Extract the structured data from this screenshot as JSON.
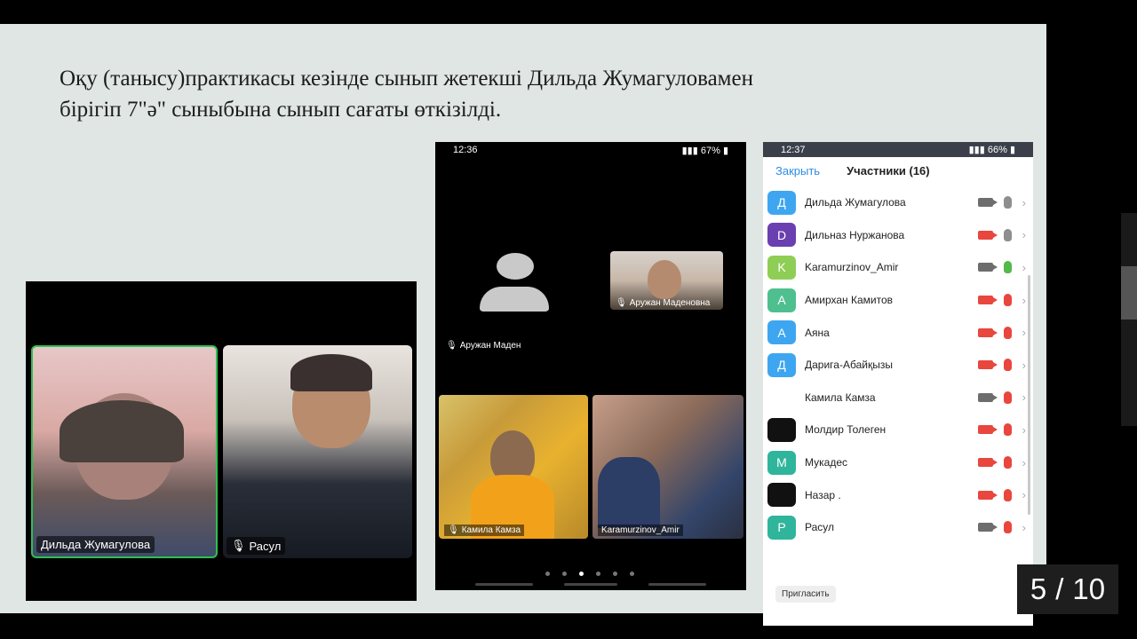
{
  "slide": {
    "heading_line1": "Оқу (танысу)практикасы кезінде сынып жетекші Дильда Жумагуловамен",
    "heading_line2": "бірігіп 7\"ә\" сыныбына сынып сағаты өткізілді."
  },
  "left_call": {
    "tiles": [
      {
        "name": "Дильда Жумагулова"
      },
      {
        "name": "Расул"
      }
    ]
  },
  "phone1": {
    "time": "12:36",
    "battery": "67%",
    "big_tile_name": "Аружан Маден",
    "tiles": [
      {
        "name": "Аружан Маденовна"
      },
      {
        "name": "Камила Камза"
      },
      {
        "name": "Karamurzinov_Amir"
      }
    ]
  },
  "phone2": {
    "time": "12:37",
    "battery": "66%",
    "close_label": "Закрыть",
    "title": "Участники (16)",
    "invite_label": "Пригласить",
    "participants": [
      {
        "initial": "Д",
        "name": "Дильда Жумагулова",
        "color": "#3ea6f0",
        "cam": "on",
        "mic": "on"
      },
      {
        "initial": "D",
        "name": "Дильназ Нуржанова",
        "color": "#6a3fb0",
        "cam": "off",
        "mic": "on"
      },
      {
        "initial": "K",
        "name": "Karamurzinov_Amir",
        "color": "#8fce55",
        "cam": "on",
        "mic": "active"
      },
      {
        "initial": "А",
        "name": "Амирхан Камитов",
        "color": "#4fbf8f",
        "cam": "off",
        "mic": "off"
      },
      {
        "initial": "А",
        "name": "Аяна",
        "color": "#3ea6f0",
        "cam": "off",
        "mic": "off"
      },
      {
        "initial": "Д",
        "name": "Дарига-Абайқызы",
        "color": "#3ea6f0",
        "cam": "off",
        "mic": "off"
      },
      {
        "initial": "",
        "name": "Камила Камза",
        "color": "#ffffff",
        "cam": "on",
        "mic": "off"
      },
      {
        "initial": "",
        "name": "Молдир Толеген",
        "color": "#111111",
        "cam": "off",
        "mic": "off"
      },
      {
        "initial": "M",
        "name": "Мукадес",
        "color": "#2fb59b",
        "cam": "off",
        "mic": "off"
      },
      {
        "initial": "",
        "name": "Назар .",
        "color": "#111111",
        "cam": "off",
        "mic": "off"
      },
      {
        "initial": "Р",
        "name": "Расул",
        "color": "#2fb59b",
        "cam": "on",
        "mic": "off"
      }
    ]
  },
  "counter": {
    "current": "5",
    "separator": "/",
    "total": "10"
  }
}
